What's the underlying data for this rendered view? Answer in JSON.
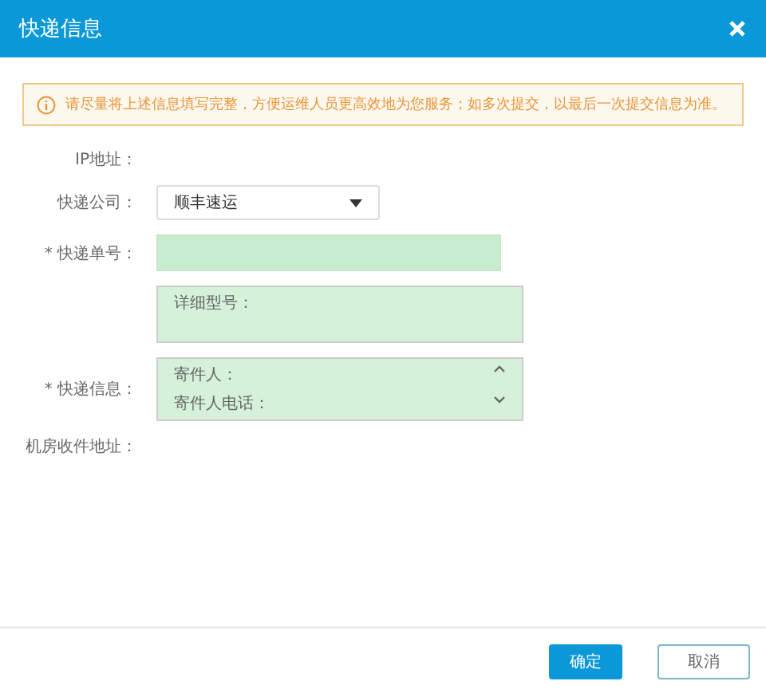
{
  "dialog": {
    "title": "快递信息"
  },
  "notice": "请尽量将上述信息填写完整，方便运维人员更高效地为您服务；如多次提交，以最后一次提交信息为准。",
  "fields": [
    {
      "kind": "text",
      "label": "IP地址："
    },
    {
      "kind": "select",
      "label": "快递公司：",
      "value": "顺丰速运"
    },
    {
      "kind": "input",
      "label": "* 快递单号："
    },
    {
      "kind": "textarea",
      "lines": [
        "详细型号："
      ]
    },
    {
      "kind": "textarea",
      "label": "* 快递信息：",
      "lines": [
        "寄件人：",
        "寄件人电话："
      ],
      "scroll": true
    },
    {
      "kind": "text",
      "label": "机房收件地址："
    }
  ],
  "buttons": [
    {
      "label": "确定",
      "kind": "primary"
    },
    {
      "label": "取消",
      "kind": "secondary"
    }
  ]
}
